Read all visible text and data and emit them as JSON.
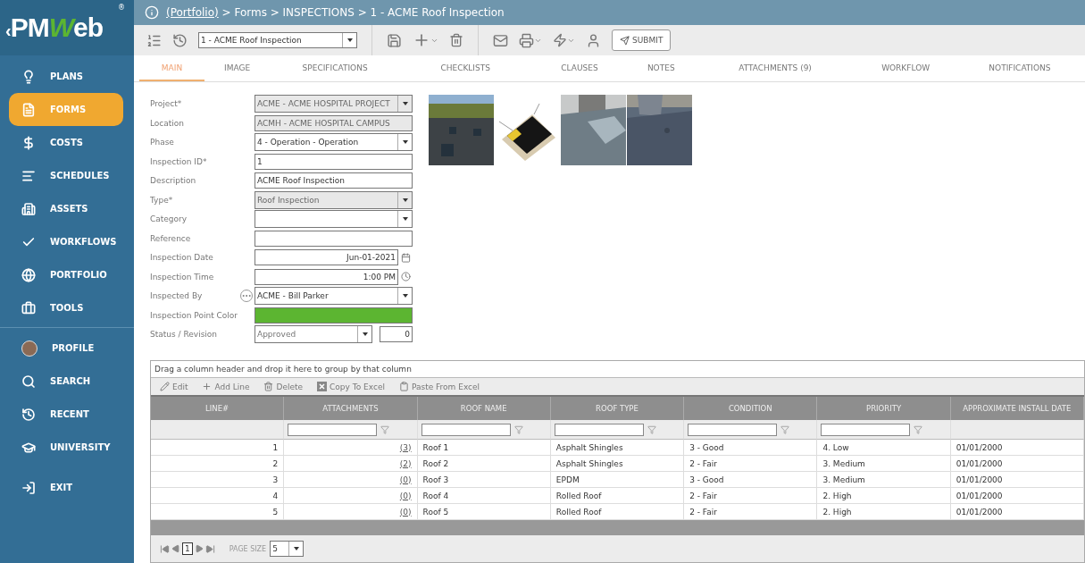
{
  "logo": {
    "back": "‹",
    "lead": "PM",
    "accent": "W",
    "tail": "eb",
    "mark": "®"
  },
  "sidebar": {
    "items": [
      {
        "label": "PLANS",
        "selected": false
      },
      {
        "label": "FORMS",
        "selected": true
      },
      {
        "label": "COSTS",
        "selected": false
      },
      {
        "label": "SCHEDULES",
        "selected": false
      },
      {
        "label": "ASSETS",
        "selected": false
      },
      {
        "label": "WORKFLOWS",
        "selected": false
      },
      {
        "label": "PORTFOLIO",
        "selected": false
      },
      {
        "label": "TOOLS",
        "selected": false
      }
    ],
    "user_items": [
      {
        "label": "PROFILE",
        "selected": false
      },
      {
        "label": "SEARCH",
        "selected": false
      },
      {
        "label": "RECENT",
        "selected": false
      },
      {
        "label": "UNIVERSITY",
        "selected": false
      }
    ],
    "exit": {
      "label": "EXIT"
    }
  },
  "breadcrumb": {
    "link": "(Portfolio)",
    "rest": " > Forms > INSPECTIONS > 1 - ACME Roof Inspection"
  },
  "toolbar": {
    "record": "1 - ACME Roof Inspection",
    "submit": "SUBMIT"
  },
  "tabs": [
    {
      "label": "MAIN",
      "selected": true
    },
    {
      "label": "IMAGE",
      "selected": false
    },
    {
      "label": "SPECIFICATIONS",
      "selected": false
    },
    {
      "label": "CHECKLISTS",
      "selected": false
    },
    {
      "label": "CLAUSES",
      "selected": false
    },
    {
      "label": "NOTES",
      "selected": false
    },
    {
      "label": "ATTACHMENTS (9)",
      "selected": false
    },
    {
      "label": "WORKFLOW",
      "selected": false
    },
    {
      "label": "NOTIFICATIONS",
      "selected": false
    }
  ],
  "fields": [
    {
      "label": "Project*",
      "value": "ACME - ACME HOSPITAL PROJECT",
      "kind": "locked-select"
    },
    {
      "label": "Location",
      "value": "ACMH - ACME HOSPITAL CAMPUS",
      "kind": "locked-text"
    },
    {
      "label": "Phase",
      "value": "4 - Operation - Operation",
      "kind": "select"
    },
    {
      "label": "Inspection ID*",
      "value": "1",
      "kind": "text"
    },
    {
      "label": "Description",
      "value": "ACME Roof Inspection",
      "kind": "text"
    },
    {
      "label": "Type*",
      "value": "Roof Inspection",
      "kind": "locked-select"
    },
    {
      "label": "Category",
      "kind": "select"
    },
    {
      "label": "Reference",
      "kind": "text"
    },
    {
      "label": "Inspection Date",
      "value": "Jun-01-2021",
      "kind": "date"
    },
    {
      "label": "Inspection Time",
      "value": "1:00 PM",
      "kind": "time"
    },
    {
      "label": "Inspected By",
      "value": "ACME - Bill Parker",
      "kind": "picker"
    },
    {
      "label": "Inspection Point Color",
      "kind": "color",
      "color": "#5cb531"
    },
    {
      "label": "Status / Revision",
      "value": "Approved",
      "revision": "0",
      "kind": "status"
    }
  ],
  "grid": {
    "group_hint": "Drag a column header and drop it here to group by that column",
    "actions": [
      {
        "label": "Edit"
      },
      {
        "label": "Add Line"
      },
      {
        "label": "Delete"
      },
      {
        "label": "Copy To Excel"
      },
      {
        "label": "Paste From Excel"
      }
    ],
    "columns": [
      {
        "label": "LINE#",
        "filterable": false,
        "kind": "number"
      },
      {
        "label": "ATTACHMENTS",
        "filterable": true,
        "kind": "link"
      },
      {
        "label": "ROOF NAME",
        "filterable": true,
        "kind": "text"
      },
      {
        "label": "ROOF TYPE",
        "filterable": true,
        "kind": "text"
      },
      {
        "label": "CONDITION",
        "filterable": true,
        "kind": "text"
      },
      {
        "label": "PRIORITY",
        "filterable": true,
        "kind": "text"
      },
      {
        "label": "APPROXIMATE INSTALL DATE",
        "filterable": false,
        "kind": "text"
      }
    ],
    "rows": [
      [
        "1",
        "(3)",
        "Roof 1",
        "Asphalt Shingles",
        "3 - Good",
        "4. Low",
        "01/01/2000"
      ],
      [
        "2",
        "(2)",
        "Roof 2",
        "Asphalt Shingles",
        "2 - Fair",
        "3. Medium",
        "01/01/2000"
      ],
      [
        "3",
        "(0)",
        "Roof 3",
        "EPDM",
        "3 - Good",
        "3. Medium",
        "01/01/2000"
      ],
      [
        "4",
        "(0)",
        "Roof 4",
        "Rolled Roof",
        "2 - Fair",
        "2. High",
        "01/01/2000"
      ],
      [
        "5",
        "(0)",
        "Roof 5",
        "Rolled Roof",
        "2 - Fair",
        "2. High",
        "01/01/2000"
      ]
    ],
    "pager": {
      "pages": [
        {
          "label": "1",
          "selected": true
        }
      ],
      "size_label": "PAGE SIZE",
      "size": "5"
    }
  }
}
